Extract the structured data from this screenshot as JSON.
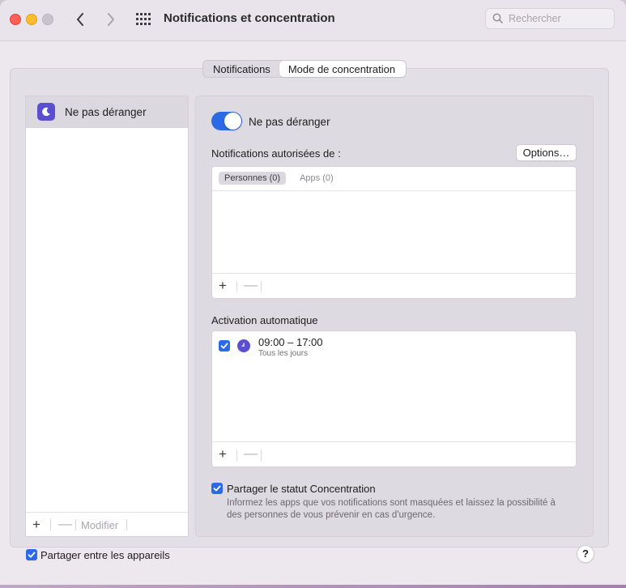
{
  "window": {
    "title": "Notifications et concentration",
    "search_placeholder": "Rechercher"
  },
  "tabs": [
    {
      "label": "Notifications",
      "active": false
    },
    {
      "label": "Mode de concentration",
      "active": true
    }
  ],
  "sidebar": {
    "items": [
      {
        "label": "Ne pas déranger",
        "icon": "moon-icon",
        "selected": true
      }
    ],
    "footer": {
      "add": "+",
      "remove": "—",
      "modify": "Modifier"
    }
  },
  "focus": {
    "toggle_on": true,
    "toggle_label": "Ne pas déranger",
    "allowed_label": "Notifications autorisées de :",
    "options_button": "Options…",
    "subtabs": [
      {
        "label": "Personnes (0)",
        "active": true
      },
      {
        "label": "Apps (0)",
        "active": false
      }
    ],
    "auto_label": "Activation automatique",
    "schedules": [
      {
        "time": "09:00 – 17:00",
        "days": "Tous les jours",
        "enabled": true
      }
    ],
    "list_footer": {
      "add": "+",
      "remove": "—"
    },
    "share_status": {
      "checked": true,
      "label": "Partager le statut Concentration",
      "description": "Informez les apps que vos notifications sont masquées et laissez la possibilité à des personnes de vous prévenir en cas d'urgence."
    }
  },
  "share_devices": {
    "checked": true,
    "label": "Partager entre les appareils"
  },
  "help_button": "?",
  "colors": {
    "accent": "#2c6ae5",
    "focus_purple": "#5b4fd0"
  }
}
